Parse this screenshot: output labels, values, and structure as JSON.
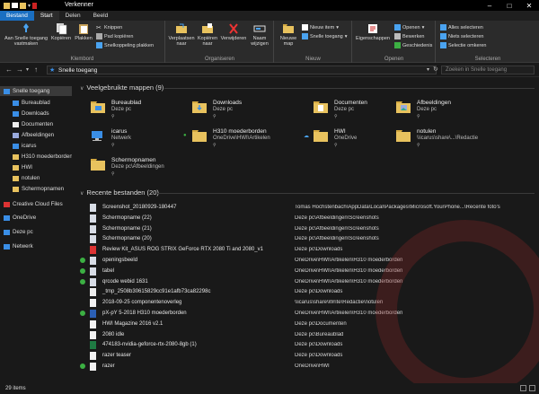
{
  "window": {
    "title": "Verkenner"
  },
  "tabs": [
    "Bestand",
    "Start",
    "Delen",
    "Beeld"
  ],
  "ribbon": {
    "klembord": {
      "label": "Klembord",
      "pin": "Aan Snelle toegang vastmaken",
      "copy": "Kopiëren",
      "paste": "Plakken",
      "cut": "Knippen",
      "copy_path": "Pad kopiëren",
      "paste_shortcut": "Snelkoppeling plakken"
    },
    "organiseren": {
      "label": "Organiseren",
      "move": "Verplaatsen naar",
      "copy_to": "Kopiëren naar",
      "delete": "Verwijderen",
      "rename": "Naam wijzigen"
    },
    "nieuw": {
      "label": "Nieuw",
      "new_folder": "Nieuwe map",
      "new_item": "Nieuw item",
      "easy_access": "Snelle toegang"
    },
    "openen": {
      "label": "Openen",
      "properties": "Eigenschappen",
      "open": "Openen",
      "edit": "Bewerken",
      "history": "Geschiedenis"
    },
    "selecteren": {
      "label": "Selecteren",
      "all": "Alles selecteren",
      "none": "Niets selecteren",
      "invert": "Selectie omkeren"
    }
  },
  "address": {
    "path": "Snelle toegang",
    "search_placeholder": "Zoeken in Snelle toegang"
  },
  "sidebar": [
    {
      "label": "Snelle toegang",
      "icon": "star-icon",
      "selected": true,
      "indent": 0
    },
    {
      "label": "Bureaublad",
      "icon": "desktop-icon",
      "indent": 1
    },
    {
      "label": "Downloads",
      "icon": "download-icon",
      "indent": 1
    },
    {
      "label": "Documenten",
      "icon": "document-icon",
      "indent": 1
    },
    {
      "label": "Afbeeldingen",
      "icon": "picture-icon",
      "indent": 1
    },
    {
      "label": "icarus",
      "icon": "network-drive-icon",
      "indent": 1
    },
    {
      "label": "H310 moederborden",
      "icon": "folder-icon",
      "indent": 1
    },
    {
      "label": "HWI",
      "icon": "folder-icon",
      "indent": 1
    },
    {
      "label": "notulen",
      "icon": "folder-icon",
      "indent": 1
    },
    {
      "label": "Schermopnamen",
      "icon": "folder-icon",
      "indent": 1
    },
    {
      "label": "Creative Cloud Files",
      "icon": "creative-cloud-icon",
      "indent": 0
    },
    {
      "label": "OneDrive",
      "icon": "cloud-icon",
      "indent": 0
    },
    {
      "label": "Deze pc",
      "icon": "computer-icon",
      "indent": 0
    },
    {
      "label": "Netwerk",
      "icon": "network-icon",
      "indent": 0
    }
  ],
  "frequent": {
    "header": "Veelgebruikte mappen (9)",
    "items": [
      {
        "name": "Bureaublad",
        "path": "Deze pc",
        "icon": "desktop-folder-icon"
      },
      {
        "name": "Downloads",
        "path": "Deze pc",
        "icon": "download-folder-icon"
      },
      {
        "name": "Documenten",
        "path": "Deze pc",
        "icon": "document-folder-icon"
      },
      {
        "name": "Afbeeldingen",
        "path": "Deze pc",
        "icon": "picture-folder-icon"
      },
      {
        "name": "icarus",
        "path": "Netwerk",
        "icon": "network-drive-icon"
      },
      {
        "name": "H310 moederborden",
        "path": "OneDrive\\HWI\\Artikelen",
        "icon": "folder-icon",
        "sync": "synced"
      },
      {
        "name": "HWI",
        "path": "OneDrive",
        "icon": "folder-icon",
        "sync": "cloud"
      },
      {
        "name": "notulen",
        "path": "\\\\icarus\\share\\...\\Redactie",
        "icon": "folder-icon"
      },
      {
        "name": "Schermopnamen",
        "path": "Deze pc\\Afbeeldingen",
        "icon": "folder-icon"
      }
    ]
  },
  "recent": {
    "header": "Recente bestanden (20)",
    "items": [
      {
        "name": "Screenshot_20180929-180447",
        "path": "Tomas Hochstenbach\\AppData\\Local\\Packages\\Microsoft.YourPhone...\\Recente foto's",
        "icon": "image-file-icon"
      },
      {
        "name": "Schermopname (22)",
        "path": "Deze pc\\Afbeeldingen\\Screenshots",
        "icon": "image-file-icon"
      },
      {
        "name": "Schermopname (21)",
        "path": "Deze pc\\Afbeeldingen\\Screenshots",
        "icon": "image-file-icon"
      },
      {
        "name": "Schermopname (20)",
        "path": "Deze pc\\Afbeeldingen\\Screenshots",
        "icon": "image-file-icon"
      },
      {
        "name": "Review Kit_ASUS ROG STRIX GeForce RTX 2080 Ti and 2080_v1",
        "path": "Deze pc\\Downloads",
        "icon": "pdf-file-icon"
      },
      {
        "name": "openingsbeeld",
        "path": "OneDrive\\HWI\\Artikelen\\H310 moederborden",
        "icon": "image-file-icon",
        "synced": true
      },
      {
        "name": "tabel",
        "path": "OneDrive\\HWI\\Artikelen\\H310 moederborden",
        "icon": "image-file-icon",
        "synced": true
      },
      {
        "name": "qrcode webid 1631",
        "path": "OneDrive\\HWI\\Artikelen\\H310 moederborden",
        "icon": "image-file-icon",
        "synced": true
      },
      {
        "name": "_tmp_2508b30615829cc91e1afb73ca82298c",
        "path": "Deze pc\\Downloads",
        "icon": "file-icon"
      },
      {
        "name": "2018-09-25 componentenoverleg",
        "path": "\\\\icarus\\share\\Write\\Redactie\\notulen",
        "icon": "document-file-icon"
      },
      {
        "name": "pX-pY 5-2018 H310 moederborden",
        "path": "OneDrive\\HWI\\Artikelen\\H310 moederborden",
        "icon": "word-file-icon",
        "synced": true
      },
      {
        "name": "HWI Magazine 2016 v2.1",
        "path": "Deze pc\\Documenten",
        "icon": "document-file-icon"
      },
      {
        "name": "2080 idle",
        "path": "Deze pc\\Bureaublad",
        "icon": "document-file-icon"
      },
      {
        "name": "474183-nvidia-geforce-rtx-2080-8gb (1)",
        "path": "Deze pc\\Downloads",
        "icon": "excel-file-icon"
      },
      {
        "name": "razer teaser",
        "path": "Deze pc\\Downloads",
        "icon": "document-file-icon"
      },
      {
        "name": "razer",
        "path": "OneDrive\\HWI",
        "icon": "document-file-icon",
        "synced": true
      }
    ]
  },
  "status": {
    "count": "29 items"
  },
  "colors": {
    "accent": "#1a6fc2",
    "folder": "#e8c25e",
    "sync_green": "#3cb043",
    "bg": "#191919"
  }
}
